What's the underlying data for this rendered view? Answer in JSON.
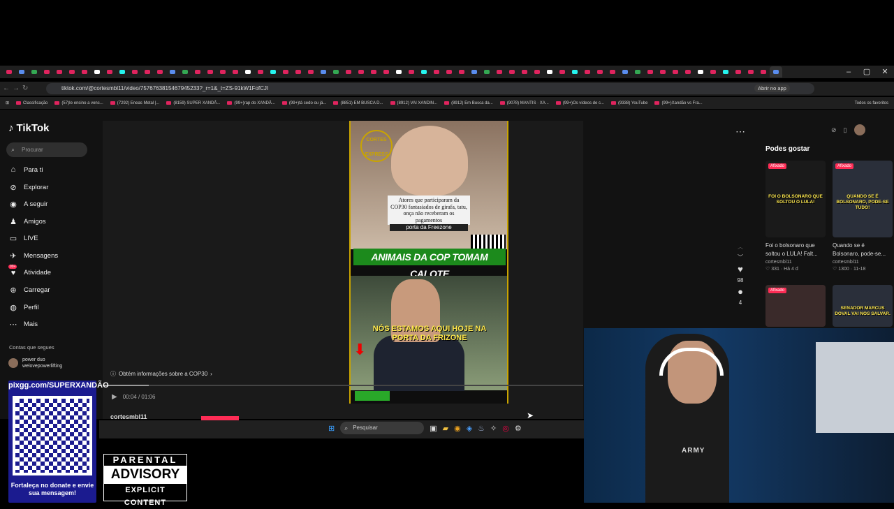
{
  "browser": {
    "url": "tiktok.com/@cortesmbl11/video/7576763815467945233?_r=1&_t=ZS-91kW1FofCJI",
    "open_in_app": "Abrir no app",
    "bookmarks": [
      "Classificação",
      "(57)Ie ensino a venc...",
      "(7292) Eneas Metal |...",
      "(8159) SUPER XANDÃ...",
      "(99+)rap do XANDÃ...",
      "(99+)tá cedo ou já...",
      "(8851) EM BUSCA D...",
      "(8912) VAI XANDIN...",
      "(8912) Em Busca da...",
      "(9078) MANTIS · XA...",
      "(99+)Os vídeos de c...",
      "(9338) YouTube",
      "(99+)Xandão vs Fra..."
    ],
    "all_favorites": "Todos os favoritos"
  },
  "tiktok": {
    "logo": "TikTok",
    "search_placeholder": "Procurar",
    "nav": [
      "Para ti",
      "Explorar",
      "A seguir",
      "Amigos",
      "LIVE",
      "Mensagens",
      "Atividade",
      "Carregar",
      "Perfil",
      "Mais"
    ],
    "activity_badge": "99+",
    "following_title": "Contas que segues",
    "following": [
      {
        "name": "power duo\nwelovepowerlifting"
      }
    ],
    "info_link": "Obtém informações sobre a COP30",
    "time": "00:04 / 01:06",
    "username": "cortesmbl11",
    "likes": "98",
    "comments": "4",
    "video": {
      "caption1": "Atores que participaram da COP30 fantasiados de girafa, tatu, onça não receberam os pagamentos",
      "caption1_tail": "porta da Freezone",
      "banner": "ANIMAIS DA COP TOMAM CALOTE",
      "caption2": "NÓS ESTAMOS AQUI HOJE NA PORTA DA FRIZONE",
      "logo": "CORTES EXPRESS"
    },
    "recommend_title": "Podes gostar",
    "recommend": [
      {
        "badge": "Afixado",
        "title": "Foi o bolsonaro que soltou o LULA! Falt...",
        "user": "cortesmbl11",
        "stats": "♡ 331 · Há 4 d",
        "overlay": "FOI O BOLSONARO QUE SOLTOU O LULA!"
      },
      {
        "badge": "Afixado",
        "title": "Quando se é Bolsonaro, pode-se...",
        "user": "cortesmbl11",
        "stats": "♡ 1300 · 11-18",
        "overlay": "QUANDO SE É BOLSONARO, PODE-SE TUDO!"
      },
      {
        "badge": "Afixado",
        "title": "",
        "user": "",
        "stats": "",
        "overlay": ""
      },
      {
        "badge": "",
        "title": "",
        "user": "",
        "stats": "",
        "overlay": "SENADOR MARCUS DOVAL VAI NOS SALVAR."
      }
    ]
  },
  "taskbar": {
    "search": "Pesquisar"
  },
  "overlay": {
    "url": "pixgg.com/SUPERXANDÃO",
    "cta": "Fortaleça no donate e envie sua mensagem!",
    "advisory_top": "PARENTAL",
    "advisory_mid": "ADVISORY",
    "advisory_bottom": "EXPLICIT CONTENT",
    "shirt": "ARMY"
  }
}
